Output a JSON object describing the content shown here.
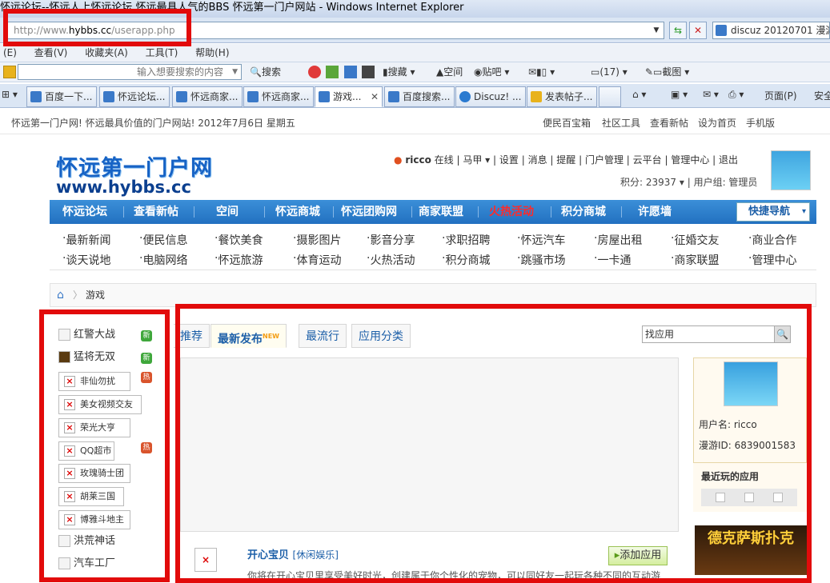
{
  "window": {
    "title": "怀远论坛--怀远人上怀远论坛 怀远最具人气的BBS 怀远第一门户网站 - Windows Internet Explorer"
  },
  "address": {
    "prefix": "http://www.",
    "domain": "hybbs.cc",
    "path": "/userapp.php",
    "search_text": "discuz 20120701 漫游不"
  },
  "menu": [
    "(E)",
    "查看(V)",
    "收藏夹(A)",
    "工具(T)",
    "帮助(H)"
  ],
  "toolbar2": {
    "input_placeholder": "输入想要搜索的内容",
    "items": [
      "搜索",
      "搜藏",
      "空间",
      "贴吧",
      "(17)",
      "截图"
    ]
  },
  "tabs": [
    {
      "label": "百度一下..."
    },
    {
      "label": "怀远论坛..."
    },
    {
      "label": "怀远商家..."
    },
    {
      "label": "怀远商家..."
    },
    {
      "label": "游戏..."
    },
    {
      "label": "百度搜索..."
    },
    {
      "label": "Discuz! ..."
    },
    {
      "label": "发表帖子..."
    }
  ],
  "tab_tools": [
    "页面(P)",
    "安全"
  ],
  "site": {
    "topinfo_left": "怀远第一门户网! 怀远最具价值的门户网站! 2012年7月6日  星期五",
    "topinfo_links": [
      "便民百宝箱",
      "社区工具",
      "查看新帖",
      "设为首页",
      "手机版"
    ],
    "logo_cn": "怀远第一门户网",
    "logo_en": "www.hybbs.cc",
    "user": {
      "name": "ricco",
      "status": "在线",
      "links": [
        "马甲",
        "设置",
        "消息",
        "提醒",
        "门户管理",
        "云平台",
        "管理中心",
        "退出"
      ],
      "points": "积分: 23937",
      "group": "用户组: 管理员"
    },
    "nav": [
      "怀远论坛",
      "查看新帖",
      "空间",
      "怀远商城",
      "怀远团购网",
      "商家联盟",
      "火热活动",
      "积分商城",
      "许愿墙"
    ],
    "quick_nav": "快捷导航",
    "subnav_row1": [
      "最新新闻",
      "便民信息",
      "餐饮美食",
      "摄影图片",
      "影音分享",
      "求职招聘",
      "怀远汽车",
      "房屋出租",
      "征婚交友",
      "商业合作"
    ],
    "subnav_row2": [
      "谈天说地",
      "电脑网络",
      "怀远旅游",
      "体育运动",
      "火热活动",
      "积分商城",
      "跳骚市场",
      "一卡通",
      "商家联盟",
      "管理中心"
    ],
    "breadcrumb": "游戏"
  },
  "left_apps": [
    {
      "name": "红警大战",
      "badge": "新"
    },
    {
      "name": "猛将无双",
      "badge": "新"
    },
    {
      "name": "非仙勿扰",
      "badge": "热"
    },
    {
      "name": "美女视频交友",
      "badge": ""
    },
    {
      "name": "荣光大亨",
      "badge": ""
    },
    {
      "name": "QQ超市",
      "badge": "热"
    },
    {
      "name": "玫瑰骑士团",
      "badge": ""
    },
    {
      "name": "胡莱三国",
      "badge": ""
    },
    {
      "name": "博雅斗地主",
      "badge": ""
    },
    {
      "name": "洪荒神话",
      "badge": ""
    },
    {
      "name": "汽车工厂",
      "badge": ""
    }
  ],
  "main": {
    "tabs": [
      "推荐",
      "最新发布",
      "最流行",
      "应用分类"
    ],
    "find_placeholder": "找应用",
    "user_name": "用户名: ricco",
    "user_id": "漫游ID: 6839001583",
    "recent_title": "最近玩的应用",
    "app_name": "开心宝贝",
    "app_category": "[休闲娱乐]",
    "add_button": "添加应用",
    "app_desc": "你将在开心宝贝里享受美好时光，创建属于你个性化的宠物，可以同好友一起玩各种不同的互动游",
    "poker_text": "德克萨斯扑克"
  },
  "colors": {
    "nav_bg": "#2a7acb",
    "annotation_red": "#e20b0b",
    "hot_red": "#e00000"
  }
}
